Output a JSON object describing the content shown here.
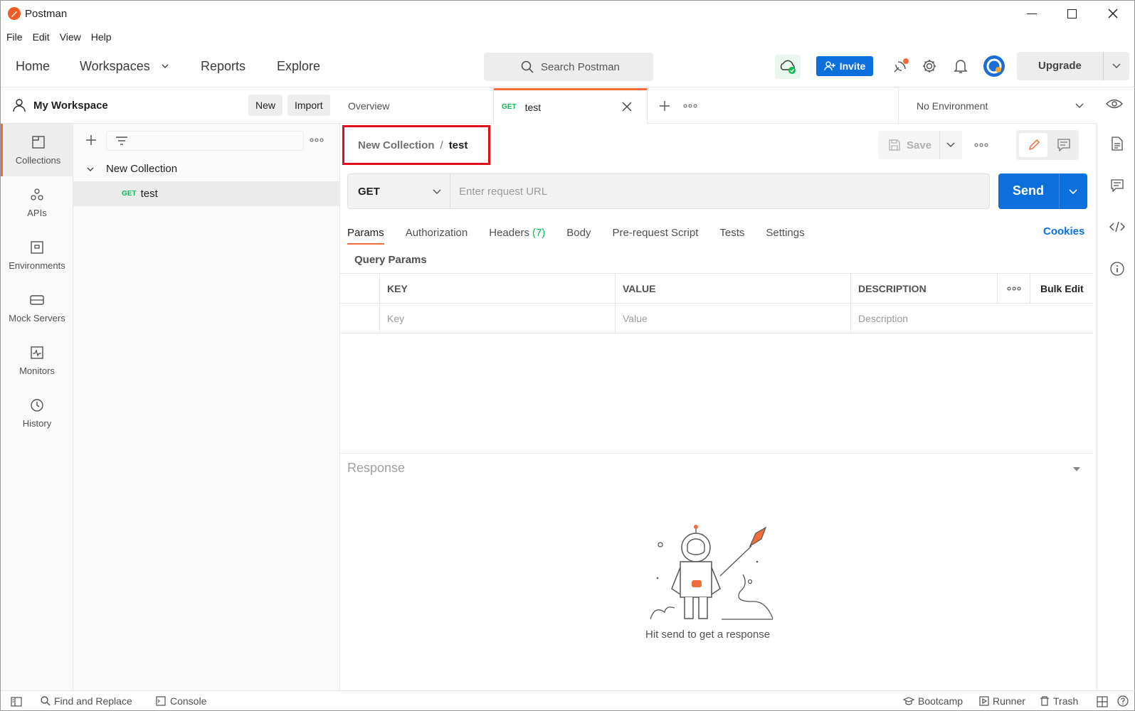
{
  "window": {
    "title": "Postman"
  },
  "menu": [
    "File",
    "Edit",
    "View",
    "Help"
  ],
  "nav": {
    "home": "Home",
    "workspaces": "Workspaces",
    "reports": "Reports",
    "explore": "Explore"
  },
  "search": {
    "placeholder": "Search Postman"
  },
  "header": {
    "invite": "Invite",
    "upgrade": "Upgrade"
  },
  "workspace": {
    "name": "My Workspace",
    "new_label": "New",
    "import_label": "Import"
  },
  "rail": [
    {
      "label": "Collections",
      "icon": "collections-icon"
    },
    {
      "label": "APIs",
      "icon": "apis-icon"
    },
    {
      "label": "Environments",
      "icon": "environments-icon"
    },
    {
      "label": "Mock Servers",
      "icon": "mock-servers-icon"
    },
    {
      "label": "Monitors",
      "icon": "monitors-icon"
    },
    {
      "label": "History",
      "icon": "history-icon"
    }
  ],
  "collections": {
    "name": "New Collection",
    "request": {
      "method": "GET",
      "name": "test"
    }
  },
  "tabs": {
    "overview": "Overview",
    "active": {
      "method": "GET",
      "name": "test"
    },
    "environment": "No Environment"
  },
  "request": {
    "breadcrumb_parent": "New Collection",
    "breadcrumb_sep": "/",
    "breadcrumb_current": "test",
    "save_label": "Save",
    "method": "GET",
    "url_placeholder": "Enter request URL",
    "send_label": "Send",
    "tabs": [
      "Params",
      "Authorization",
      "Headers",
      "Body",
      "Pre-request Script",
      "Tests",
      "Settings"
    ],
    "headers_count": "(7)",
    "cookies": "Cookies",
    "query_params_title": "Query Params",
    "columns": {
      "key": "KEY",
      "value": "VALUE",
      "description": "DESCRIPTION",
      "bulk_edit": "Bulk Edit"
    },
    "placeholders": {
      "key": "Key",
      "value": "Value",
      "description": "Description"
    }
  },
  "response": {
    "title": "Response",
    "empty": "Hit send to get a response"
  },
  "statusbar": {
    "find_replace": "Find and Replace",
    "console": "Console",
    "bootcamp": "Bootcamp",
    "runner": "Runner",
    "trash": "Trash"
  },
  "colors": {
    "accent": "#f26b3a",
    "primary": "#0b6fde",
    "get": "#0cbb52",
    "highlight": "#e00d1b"
  }
}
